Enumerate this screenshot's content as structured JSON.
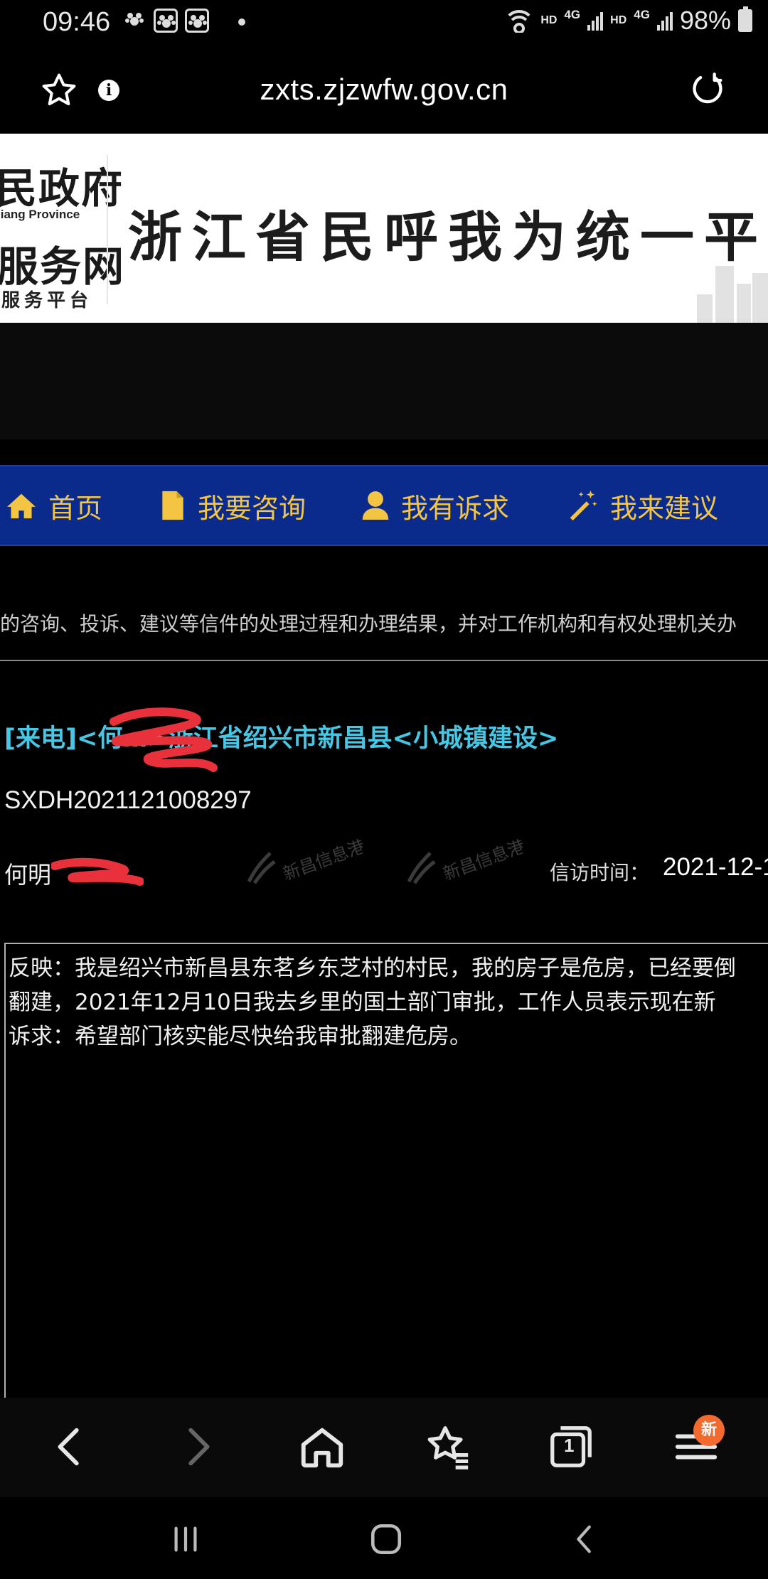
{
  "status_bar": {
    "time": "09:46",
    "network_hd": "HD",
    "network_gen": "4G",
    "battery": "98%"
  },
  "browser": {
    "url": "zxts.zjzwfw.gov.cn",
    "tab_count": "1",
    "new_badge": "新"
  },
  "banner": {
    "logo_line1": "民政府",
    "logo_en": "jiang Province",
    "logo_line2": "服务网",
    "logo_sub": "服务平台",
    "title": "浙江省民呼我为统一平"
  },
  "nav": {
    "items": [
      {
        "label": "首页",
        "icon": "home-icon"
      },
      {
        "label": "我要咨询",
        "icon": "document-icon"
      },
      {
        "label": "我有诉求",
        "icon": "user-icon"
      },
      {
        "label": "我来建议",
        "icon": "magic-wand-icon"
      }
    ]
  },
  "notice": "的咨询、投诉、建议等信件的处理过程和办理结果，并对工作机构和有权处理机关办",
  "letter": {
    "title": "[来电]<何…>浙江省绍兴市新昌县<小城镇建设>",
    "id": "SXDH2021121008297",
    "petitioner": "何明",
    "visit_label": "信访时间：",
    "visit_value": "2021-12-1",
    "content": [
      "反映：我是绍兴市新昌县东茗乡东芝村的村民，我的房子是危房，已经要倒",
      "翻建，2021年12月10日我去乡里的国土部门审批，工作人员表示现在新",
      "诉求：希望部门核实能尽快给我审批翻建危房。"
    ]
  },
  "colors": {
    "nav_bg": "#0a2a8c",
    "nav_text": "#f4c542",
    "title_link": "#45c8e6",
    "badge": "#f26a2e"
  }
}
